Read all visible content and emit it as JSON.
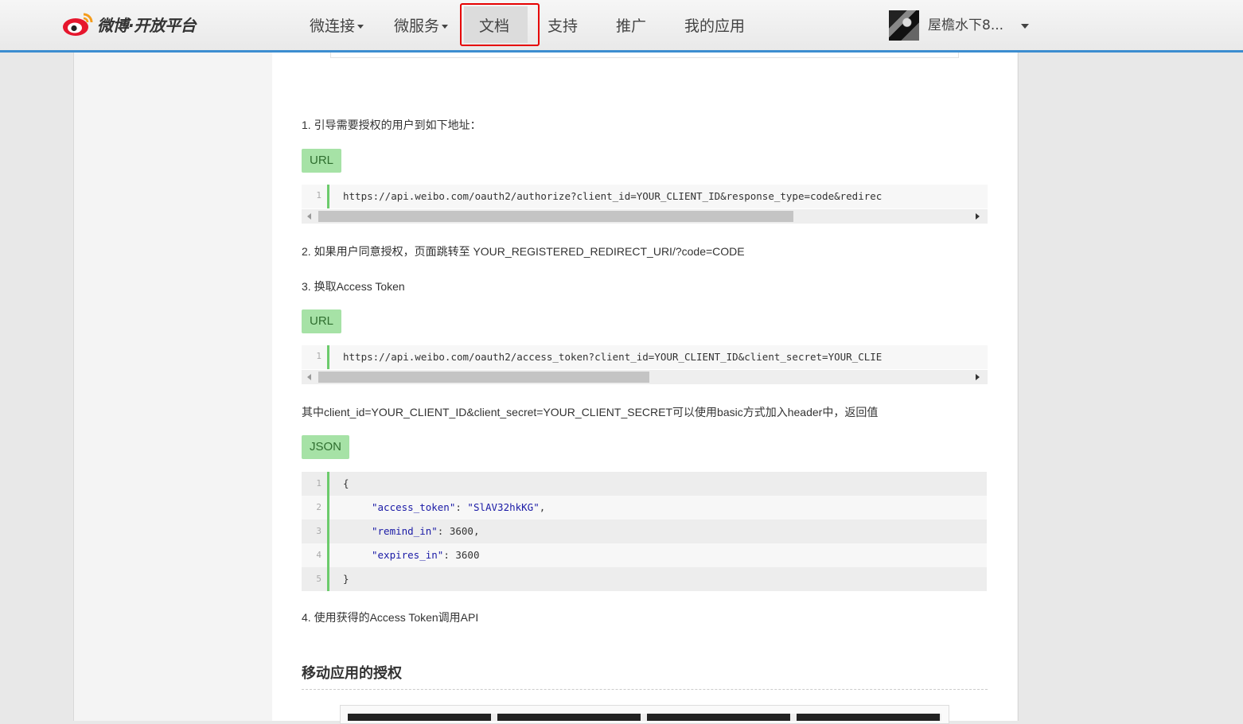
{
  "header": {
    "logo_text": "微博·开放平台",
    "nav": [
      {
        "label": "微连接",
        "has_menu": true
      },
      {
        "label": "微服务",
        "has_menu": true
      },
      {
        "label": "文档",
        "active": true
      },
      {
        "label": "支持"
      },
      {
        "label": "推广"
      },
      {
        "label": "我的应用"
      }
    ],
    "username": "屋檐水下8..."
  },
  "content": {
    "step1": "1. 引导需要授权的用户到如下地址：",
    "url_tag_1": "URL",
    "code1": {
      "line_no": "1",
      "text": "https://api.weibo.com/oauth2/authorize?client_id=YOUR_CLIENT_ID&response_type=code&redirec"
    },
    "step2": "2. 如果用户同意授权，页面跳转至 YOUR_REGISTERED_REDIRECT_URI/?code=CODE",
    "step3": "3. 换取Access Token",
    "url_tag_2": "URL",
    "code2": {
      "line_no": "1",
      "text": "https://api.weibo.com/oauth2/access_token?client_id=YOUR_CLIENT_ID&client_secret=YOUR_CLIE"
    },
    "note": "其中client_id=YOUR_CLIENT_ID&client_secret=YOUR_CLIENT_SECRET可以使用basic方式加入header中，返回值",
    "json_tag": "JSON",
    "json_lines": [
      {
        "n": "1",
        "t": "{"
      },
      {
        "n": "2",
        "key": "\"access_token\"",
        "sep": ": ",
        "val": "\"SlAV32hkKG\"",
        "end": ","
      },
      {
        "n": "3",
        "key": "\"remind_in\"",
        "sep": ": ",
        "val": "3600",
        "end": ","
      },
      {
        "n": "4",
        "key": "\"expires_in\"",
        "sep": ": ",
        "val": "3600",
        "end": ""
      },
      {
        "n": "5",
        "t": "}"
      }
    ],
    "step4": "4. 使用获得的Access Token调用API",
    "section_title": "移动应用的授权"
  },
  "colors": {
    "nav_border": "#3c8dd0",
    "highlight": "#e60000",
    "tag_bg": "#a6e2a6",
    "gutter": "#6ccb6c"
  },
  "scrollbars": {
    "code1_visible_fraction": 0.69,
    "code2_visible_fraction": 0.49
  }
}
